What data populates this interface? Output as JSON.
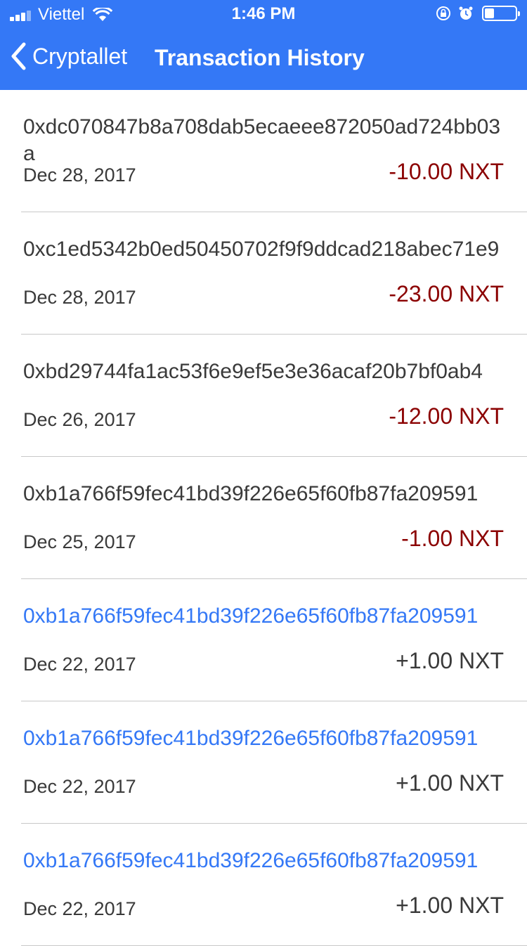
{
  "status_bar": {
    "carrier": "Viettel",
    "time": "1:46 PM",
    "battery_level": 0.3
  },
  "nav": {
    "back_label": "Cryptallet",
    "title": "Transaction History"
  },
  "colors": {
    "header_bg": "#3478f6",
    "outgoing_amount": "#8b0000",
    "incoming_hash": "#3478f6",
    "text": "#3a3a3a"
  },
  "transactions": [
    {
      "hash": "0xdc070847b8a708dab5ecaeee872050ad724bb03a",
      "date": "Dec 28, 2017",
      "amount": "-10.00 NXT",
      "direction": "out"
    },
    {
      "hash": "0xc1ed5342b0ed50450702f9f9ddcad218abec71e9",
      "date": "Dec 28, 2017",
      "amount": "-23.00 NXT",
      "direction": "out"
    },
    {
      "hash": "0xbd29744fa1ac53f6e9ef5e3e36acaf20b7bf0ab4",
      "date": "Dec 26, 2017",
      "amount": "-12.00 NXT",
      "direction": "out"
    },
    {
      "hash": "0xb1a766f59fec41bd39f226e65f60fb87fa209591",
      "date": "Dec 25, 2017",
      "amount": "-1.00 NXT",
      "direction": "out"
    },
    {
      "hash": "0xb1a766f59fec41bd39f226e65f60fb87fa209591",
      "date": "Dec 22, 2017",
      "amount": "+1.00 NXT",
      "direction": "in"
    },
    {
      "hash": "0xb1a766f59fec41bd39f226e65f60fb87fa209591",
      "date": "Dec 22, 2017",
      "amount": "+1.00 NXT",
      "direction": "in"
    },
    {
      "hash": "0xb1a766f59fec41bd39f226e65f60fb87fa209591",
      "date": "Dec 22, 2017",
      "amount": "+1.00 NXT",
      "direction": "in"
    }
  ]
}
